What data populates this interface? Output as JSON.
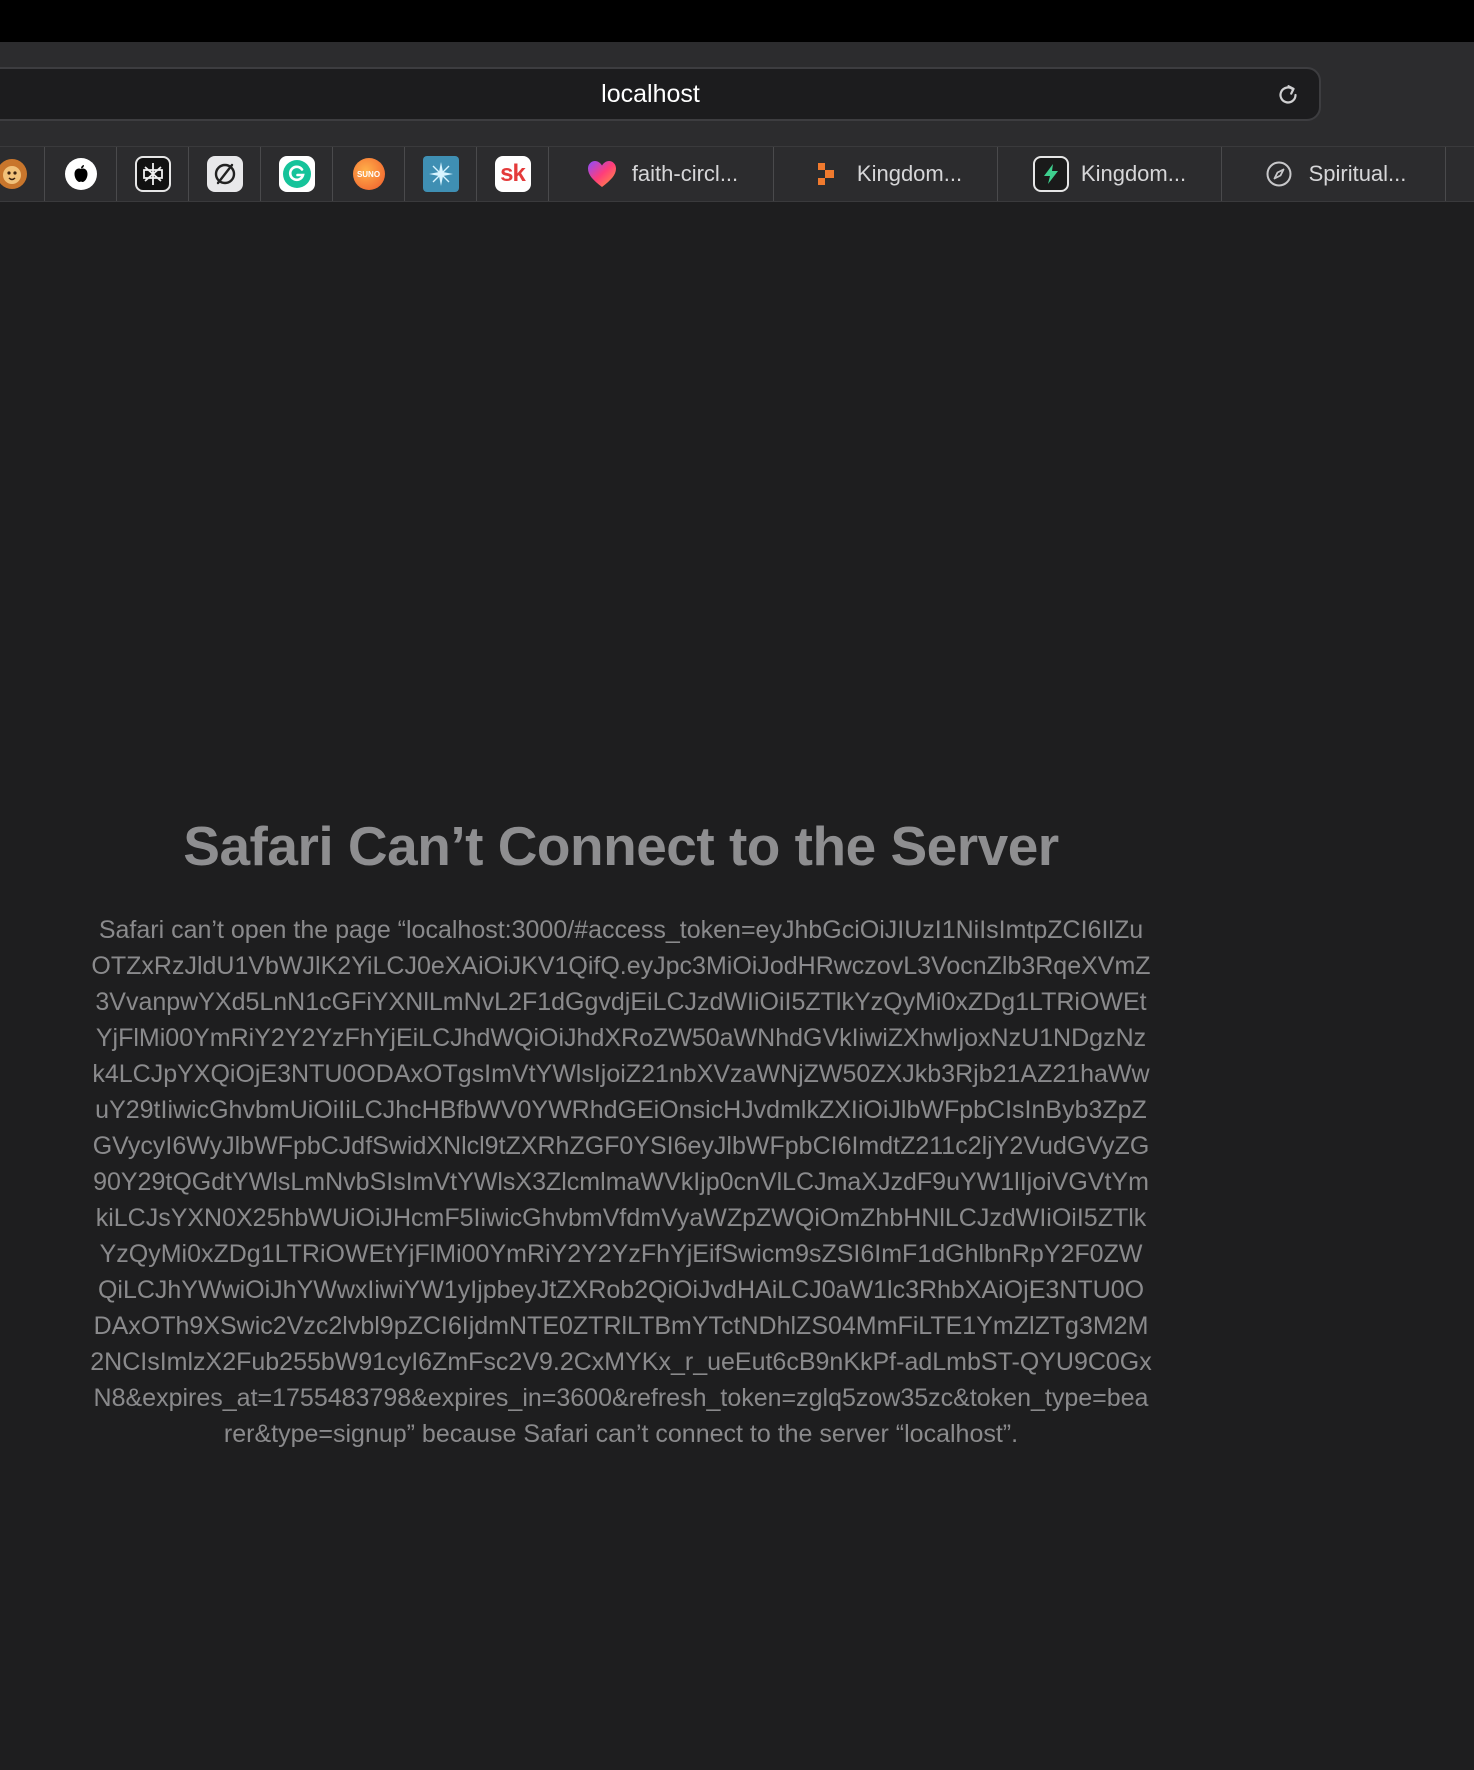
{
  "address_bar": {
    "text": "localhost"
  },
  "favorites": [
    {
      "icon": "lion-icon",
      "label": ""
    },
    {
      "icon": "apple-icon",
      "label": ""
    },
    {
      "icon": "perplexity-icon",
      "label": ""
    },
    {
      "icon": "slashed-circle-icon",
      "label": ""
    },
    {
      "icon": "grammarly-icon",
      "label": ""
    },
    {
      "icon": "suno-icon",
      "label": "SUNO"
    },
    {
      "icon": "spark-star-icon",
      "label": ""
    },
    {
      "icon": "sk-icon",
      "label": "sk"
    },
    {
      "icon": "heart-gradient-icon",
      "label": "faith-circl..."
    },
    {
      "icon": "orange-blocks-icon",
      "label": "Kingdom..."
    },
    {
      "icon": "lightning-icon",
      "label": "Kingdom..."
    },
    {
      "icon": "compass-icon",
      "label": "Spiritual..."
    }
  ],
  "error": {
    "title": "Safari Can’t Connect to the Server",
    "message": "Safari can’t open the page “localhost:3000/#access_token=eyJhbGciOiJIUzI1NiIsImtpZCI6IlZuOTZxRzJldU1VbWJlK2YiLCJ0eXAiOiJKV1QifQ.eyJpc3MiOiJodHRwczovL3VocnZlb3RqeXVmZ3VvanpwYXd5LnN1cGFiYXNlLmNvL2F1dGgvdjEiLCJzdWIiOiI5ZTlkYzQyMi0xZDg1LTRiOWEtYjFlMi00YmRiY2Y2YzFhYjEiLCJhdWQiOiJhdXRoZW50aWNhdGVkIiwiZXhwIjoxNzU1NDgzNzk4LCJpYXQiOjE3NTU0ODAxOTgsImVtYWlsIjoiZ21nbXVzaWNjZW50ZXJkb3Rjb21AZ21haWwuY29tIiwicGhvbmUiOiIiLCJhcHBfbWV0YWRhdGEiOnsicHJvdmlkZXIiOiJlbWFpbCIsInByb3ZpZGVycyI6WyJlbWFpbCJdfSwidXNlcl9tZXRhZGF0YSI6eyJlbWFpbCI6ImdtZ211c2ljY2VudGVyZG90Y29tQGdtYWlsLmNvbSIsImVtYWlsX3ZlcmlmaWVkIjp0cnVlLCJmaXJzdF9uYW1lIjoiVGVtYmkiLCJsYXN0X25hbWUiOiJHcmF5IiwicGhvbmVfdmVyaWZpZWQiOmZhbHNlLCJzdWIiOiI5ZTlkYzQyMi0xZDg1LTRiOWEtYjFlMi00YmRiY2Y2YzFhYjEifSwicm9sZSI6ImF1dGhlbnRpY2F0ZWQiLCJhYWwiOiJhYWwxIiwiYW1yIjpbeyJtZXRob2QiOiJvdHAiLCJ0aW1lc3RhbXAiOjE3NTU0ODAxOTh9XSwic2Vzc2lvbl9pZCI6IjdmNTE0ZTRlLTBmYTctNDhlZS04MmFiLTE1YmZlZTg3M2M2NCIsImlzX2Fub255bW91cyI6ZmFsc2V9.2CxMYKx_r_ueEut6cB9nKkPf-adLmbST-QYU9C0GxN8&expires_at=1755483798&expires_in=3600&refresh_token=zglq5zow35zc&token_type=bearer&type=signup” because Safari can’t connect to the server “localhost”."
  }
}
